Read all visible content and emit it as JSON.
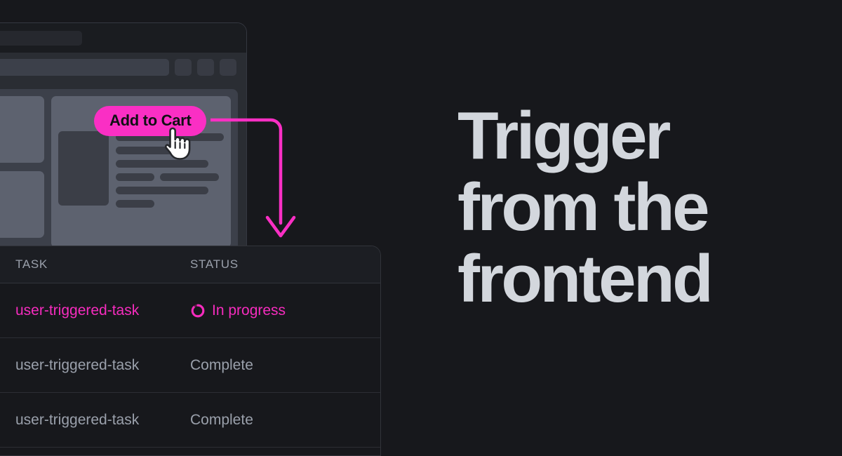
{
  "background_color": "#17181c",
  "accent_color": "#fa2fc4",
  "headline": {
    "line1": "Trigger",
    "line2": "from the",
    "line3": "frontend"
  },
  "browser": {
    "tab_label": "",
    "url_value": "",
    "toolbar_buttons": [
      "button-1",
      "button-2",
      "button-3"
    ],
    "page": {
      "thumbnails": [
        "thumbnail-1",
        "thumbnail-2"
      ],
      "detail_image": "product-image-placeholder",
      "detail_lines": [
        "line-1",
        "line-2",
        "line-3",
        "line-4a",
        "line-4b",
        "line-5",
        "line-6"
      ]
    }
  },
  "cta": {
    "label": "Add to Cart",
    "cursor_icon": "pointing-hand-cursor",
    "button_color": "#fa2fc4",
    "text_color": "#0f1013"
  },
  "connector": {
    "icon": "curved-arrow-down",
    "color": "#fa2fc4"
  },
  "task_table": {
    "columns": [
      "TASK",
      "STATUS"
    ],
    "rows": [
      {
        "task": "user-triggered-task",
        "status": "In progress",
        "status_icon": "spinner-icon",
        "active": true,
        "color": "#f62cbe"
      },
      {
        "task": "user-triggered-task",
        "status": "Complete",
        "status_icon": "",
        "active": false,
        "color": "#9aa0ab"
      },
      {
        "task": "user-triggered-task",
        "status": "Complete",
        "status_icon": "",
        "active": false,
        "color": "#9aa0ab"
      }
    ]
  }
}
